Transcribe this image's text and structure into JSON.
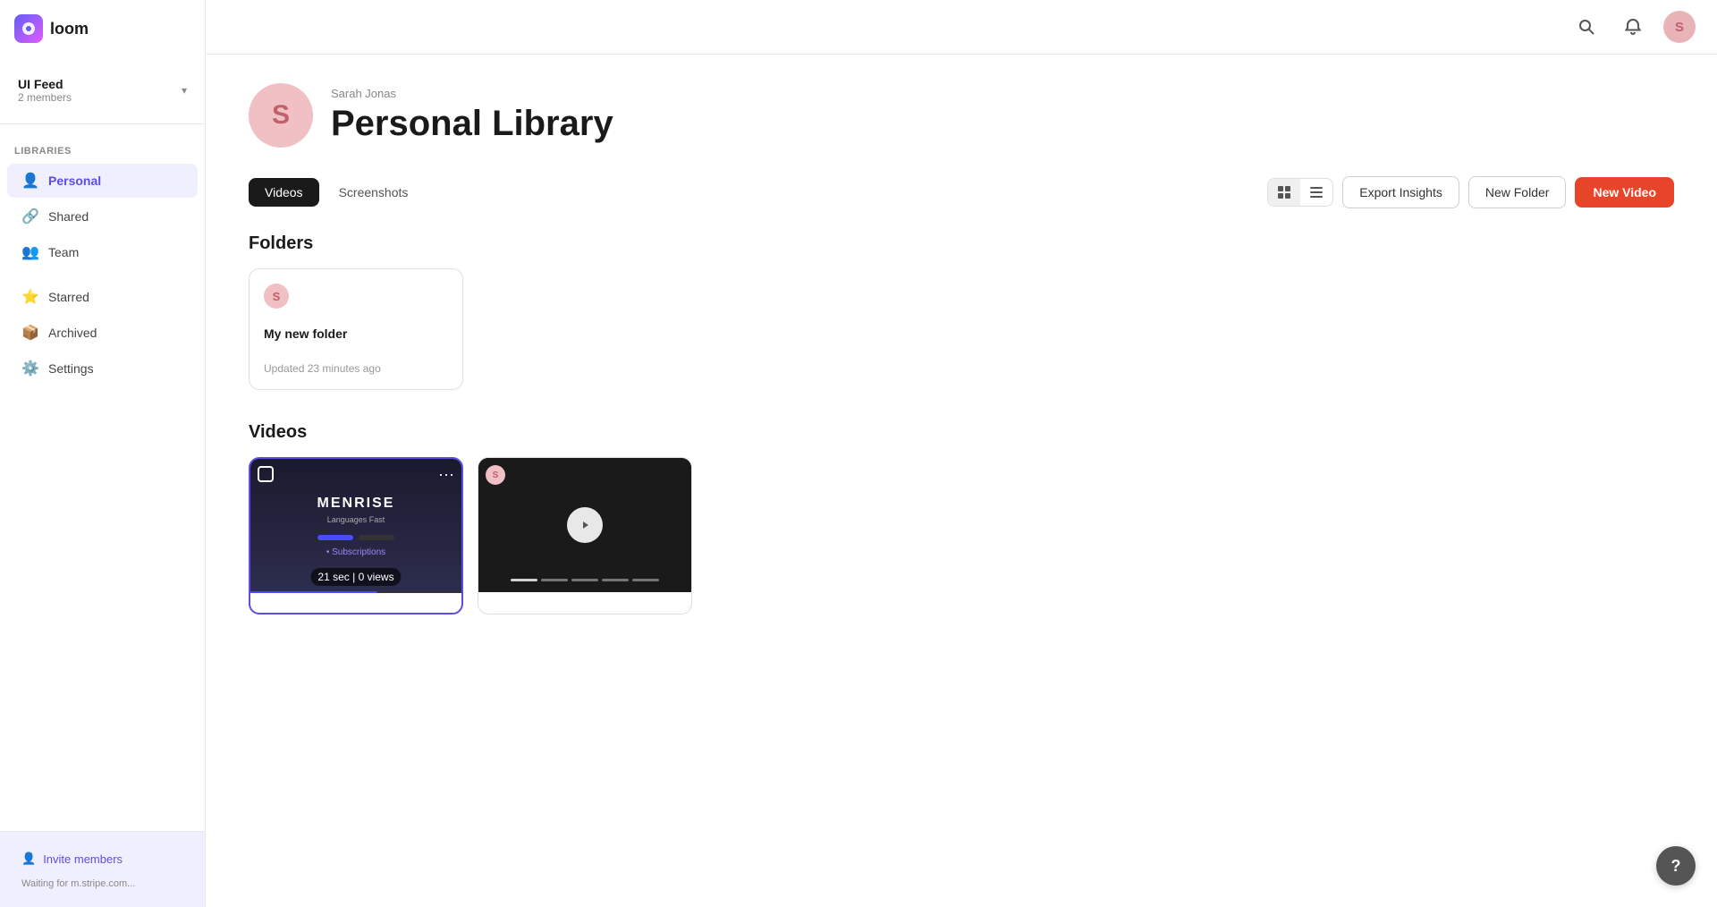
{
  "logo": {
    "text": "loom"
  },
  "workspace": {
    "name": "UI Feed",
    "members": "2 members"
  },
  "sidebar": {
    "libraries_label": "Libraries",
    "items": [
      {
        "id": "personal",
        "label": "Personal",
        "icon": "👤",
        "active": true
      },
      {
        "id": "shared",
        "label": "Shared",
        "icon": "🔗",
        "active": false
      },
      {
        "id": "team",
        "label": "Team",
        "icon": "👥",
        "active": false
      }
    ],
    "other_items": [
      {
        "id": "starred",
        "label": "Starred",
        "icon": "⭐",
        "active": false
      },
      {
        "id": "archived",
        "label": "Archived",
        "icon": "📦",
        "active": false
      },
      {
        "id": "settings",
        "label": "Settings",
        "icon": "⚙️",
        "active": false
      }
    ],
    "invite_label": "Invite members",
    "status": "Waiting for m.stripe.com..."
  },
  "page": {
    "user_initial": "S",
    "user_name": "Sarah Jonas",
    "title": "Personal Library"
  },
  "tabs": [
    {
      "id": "videos",
      "label": "Videos",
      "active": true
    },
    {
      "id": "screenshots",
      "label": "Screenshots",
      "active": false
    }
  ],
  "toolbar": {
    "export_insights": "Export Insights",
    "new_folder": "New Folder",
    "new_video": "New Video"
  },
  "folders_section": {
    "title": "Folders",
    "items": [
      {
        "initial": "S",
        "name": "My new folder",
        "updated": "Updated 23 minutes ago"
      }
    ]
  },
  "videos_section": {
    "title": "Videos",
    "items": [
      {
        "id": "v1",
        "duration": "21 sec | 0 views",
        "selected": true
      },
      {
        "id": "v2",
        "initial": "S",
        "selected": false
      }
    ]
  },
  "topbar": {
    "search_title": "Search",
    "notifications_title": "Notifications",
    "user_initial": "S"
  },
  "help": "?"
}
